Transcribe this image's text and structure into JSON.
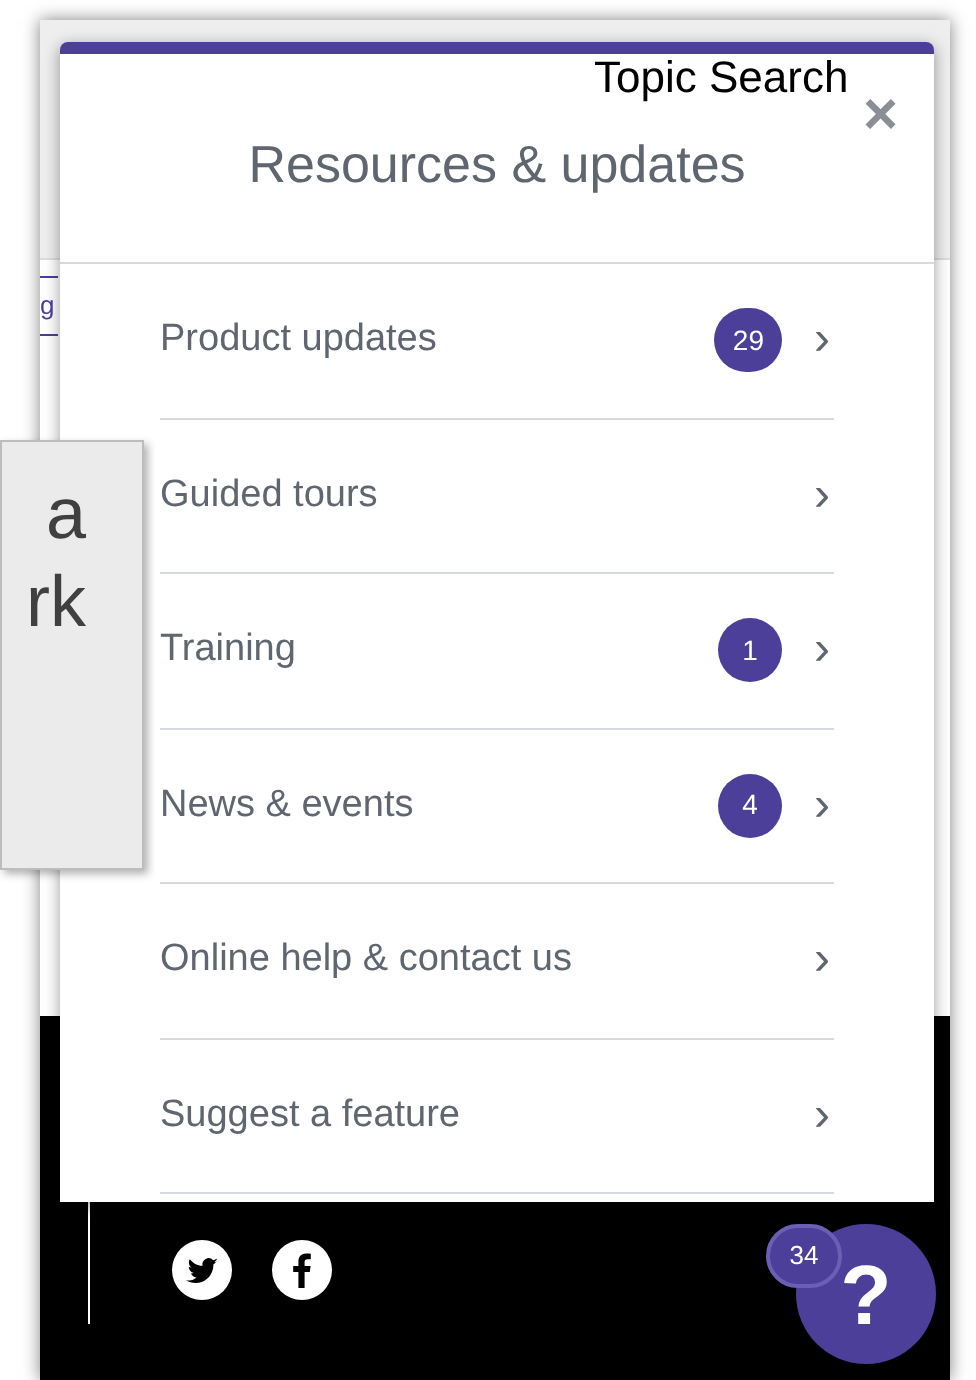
{
  "background": {
    "link_fragment": "g",
    "tooltip_lines": [
      "a",
      "rk"
    ],
    "footer": {
      "social": [
        {
          "kind": "twitter"
        },
        {
          "kind": "facebook"
        }
      ]
    },
    "help": {
      "symbol": "?",
      "badge": "34"
    }
  },
  "topic_search": "Topic Search",
  "panel": {
    "title": "Resources & updates",
    "close": "×",
    "items": [
      {
        "label": "Product updates",
        "badge": "29",
        "chevron": "›"
      },
      {
        "label": "Guided tours",
        "chevron": "›"
      },
      {
        "label": "Training",
        "badge": "1",
        "chevron": "›"
      },
      {
        "label": "News & events",
        "badge": "4",
        "chevron": "›"
      },
      {
        "label": "Online help & contact us",
        "chevron": "›"
      },
      {
        "label": "Suggest a feature",
        "chevron": "›"
      }
    ]
  }
}
